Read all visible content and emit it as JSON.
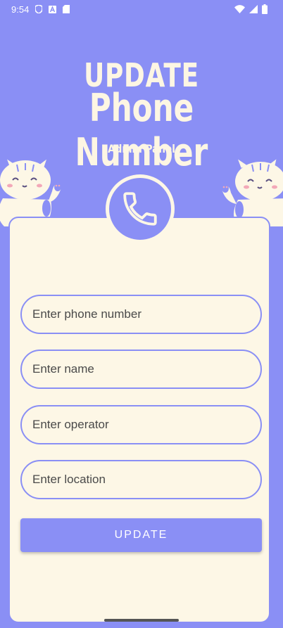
{
  "status_bar": {
    "time": "9:54",
    "left_icons": [
      "shield-icon",
      "a-icon",
      "sd-card-icon"
    ],
    "right_icons": [
      "wifi-icon",
      "signal-icon",
      "battery-icon"
    ]
  },
  "header": {
    "title_line1": "UPDATE",
    "title_line2": "Phone Number",
    "subtitle": "Admin Panel"
  },
  "form": {
    "phone_placeholder": "Enter phone number",
    "name_placeholder": "Enter name",
    "operator_placeholder": "Enter operator",
    "location_placeholder": "Enter location",
    "submit_label": "UPDATE"
  },
  "colors": {
    "background": "#8a8ff5",
    "card": "#fdf7e6",
    "accent": "#8a8ff5",
    "title_text": "#fdf6e3"
  }
}
